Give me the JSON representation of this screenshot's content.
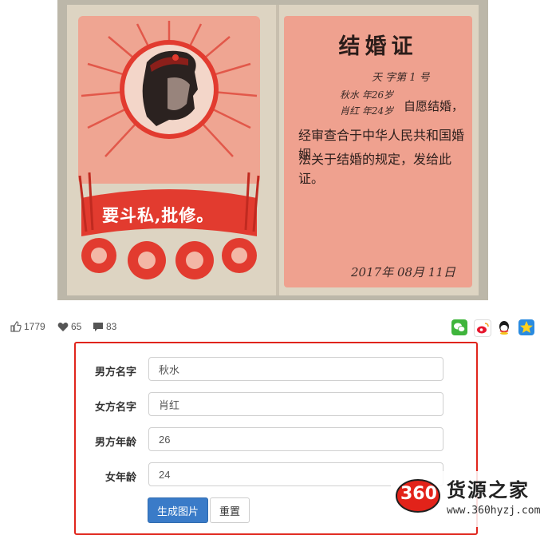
{
  "certificate": {
    "title": "结婚证",
    "serial": "天 字第 1 号",
    "line_groom": "秋水 年26岁",
    "line_bride": "肖红 年24岁",
    "line_voluntary": "自愿结婚，",
    "body_line1": "经审查合于中华人民共和国婚姻",
    "body_line2": "法关于结婚的规定，发给此证。",
    "date": "2017年 08月 11日",
    "slogan": "要斗私,批修。"
  },
  "stats": {
    "likes": "1779",
    "favorites": "65",
    "comments": "83"
  },
  "share_icons": [
    "wechat-icon",
    "weibo-icon",
    "qq-icon",
    "qzone-icon"
  ],
  "form": {
    "groom_name_label": "男方名字",
    "groom_name_value": "秋水",
    "bride_name_label": "女方名字",
    "bride_name_value": "肖红",
    "groom_age_label": "男方年龄",
    "groom_age_value": "26",
    "bride_age_label": "女年龄",
    "bride_age_value": "24",
    "generate_button": "生成图片",
    "reset_button": "重置"
  },
  "watermark": {
    "logo_text": "360",
    "site_name": "货源之家",
    "url": "www.360hyzj.com"
  },
  "colors": {
    "accent_red": "#e0251c",
    "primary_blue": "#3a7bc8",
    "cert_pink": "#efa18f"
  }
}
